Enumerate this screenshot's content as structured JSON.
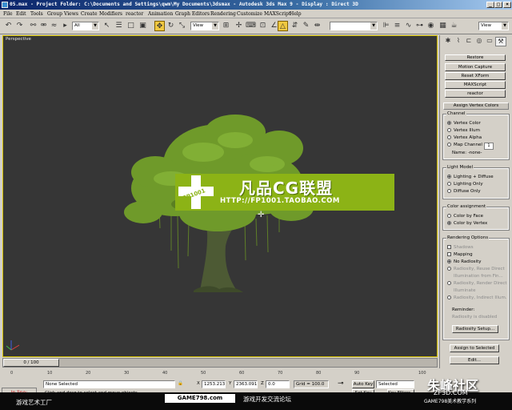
{
  "window": {
    "title": "05.max - Project Folder: C:\\Documents and Settings\\qwm\\My Documents\\3dsmax - Autodesk 3ds Max 9 - Display : Direct 3D"
  },
  "menu": [
    "File",
    "Edit",
    "Tools",
    "Group",
    "Views",
    "Create",
    "Modifiers",
    "reactor",
    "Animation",
    "Graph Editors",
    "Rendering",
    "Customize",
    "MAXScript",
    "Help"
  ],
  "toolbar": {
    "selection_filter": "All",
    "ref_coord": "View",
    "named_sets": ""
  },
  "viewport": {
    "label": "Perspective",
    "banner_title": "凡品CG联盟",
    "banner_url": "HTTP://FP1001.TAOBAO.COM",
    "banner_logo_text": "FP1001"
  },
  "command_panel": {
    "top_buttons": [
      "Restore",
      "Motion Capture",
      "Reset XForm",
      "MAXScript",
      "reactor"
    ],
    "rollout_title": "Assign Vertex Colors",
    "channel": {
      "title": "Channel",
      "options": [
        "Vertex Color",
        "Vertex Illum",
        "Vertex Alpha",
        "Map Channel"
      ],
      "map_channel_value": "1",
      "name_label": "Name: -none-"
    },
    "light_model": {
      "title": "Light Model",
      "options": [
        "Lighting + Diffuse",
        "Lighting Only",
        "Diffuse Only"
      ]
    },
    "color_assignment": {
      "title": "Color assignment",
      "options": [
        "Color by Face",
        "Color by Vertex"
      ]
    },
    "rendering_options": {
      "title": "Rendering Options",
      "checks": [
        "Shadows",
        "Mapping"
      ],
      "radios": [
        "No Radiosity",
        "Radiosity, Reuse Direct",
        "Radiosity, Render Direct",
        "Radiosity, Indirect Illum."
      ],
      "sub_disabled_1": "Illumination from Fin...",
      "sub_disabled_2": "Illuminate",
      "reminder_label": "Reminder:",
      "reminder_value": "Radiosity is disabled",
      "setup_button": "Radiosity Setup..."
    },
    "assign_button": "Assign to Selected",
    "edit_button": "Edit..."
  },
  "timeline": {
    "slider_label": "0 / 100",
    "ticks": [
      "0",
      "10",
      "20",
      "30",
      "40",
      "50",
      "60",
      "70",
      "80",
      "90",
      "100"
    ]
  },
  "status": {
    "selection": "None Selected",
    "prompt": "Click and drag to select and move objects",
    "x_label": "X",
    "x_value": "1253.213",
    "y_label": "Y",
    "y_value": "2363.091",
    "z_label": "Z",
    "z_value": "0.0",
    "grid": "Grid = 100.0",
    "auto_key": "Auto Key",
    "set_key": "Set Key",
    "selected": "Selected",
    "key_filters": "Key Filters...",
    "add_time_tag": "Add Time Tag",
    "inline": "In line:"
  },
  "footer": {
    "left": "游戏艺术工厂",
    "center_site": "GAME798.com",
    "center_text": "游戏开发交流论坛",
    "right": "GAME798美术教学系列",
    "watermark_big": "朱峰社区",
    "watermark_small": "ZF3D.COM"
  },
  "colors": {
    "viewport_bg": "#363636",
    "banner_bg": "#8cb316",
    "foliage": "#6f9a2a",
    "trunk": "#4d5a34",
    "titlebar": "#0a246a"
  }
}
